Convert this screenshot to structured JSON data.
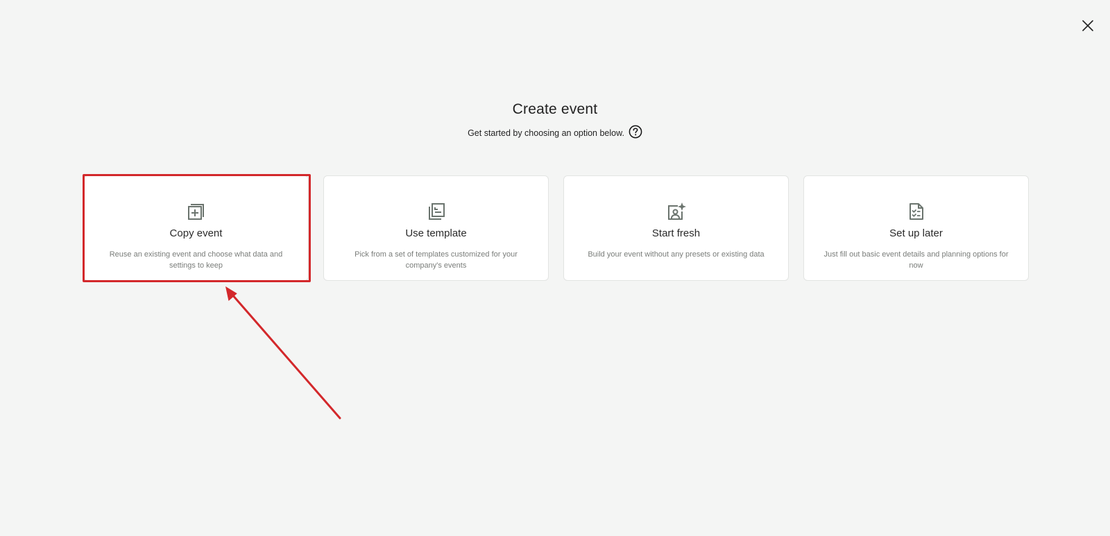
{
  "dialog": {
    "title": "Create event",
    "subtitle": "Get started by choosing an option below."
  },
  "options": [
    {
      "title": "Copy event",
      "description": "Reuse an existing event and choose what data and settings to keep",
      "icon": "copy-plus-icon"
    },
    {
      "title": "Use template",
      "description": "Pick from a set of templates customized for your company's events",
      "icon": "template-icon"
    },
    {
      "title": "Start fresh",
      "description": "Build your event without any presets or existing data",
      "icon": "portrait-sparkle-icon"
    },
    {
      "title": "Set up later",
      "description": "Just fill out basic event details and planning options for now",
      "icon": "checklist-document-icon"
    }
  ],
  "colors": {
    "background": "#f4f5f4",
    "card": "#ffffff",
    "icon": "#6b746e",
    "annotation": "#d3282b"
  }
}
